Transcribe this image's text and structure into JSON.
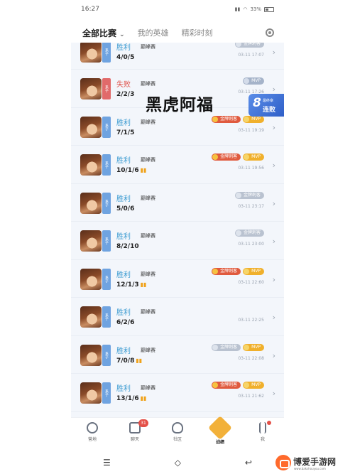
{
  "status_bar": {
    "time": "16:27",
    "battery": "33%"
  },
  "tabs": [
    {
      "label": "全部比赛",
      "active": true
    },
    {
      "label": "我的英雄",
      "active": false
    },
    {
      "label": "精彩时刻",
      "active": false
    }
  ],
  "overlay_text": "黑虎阿福",
  "streak": {
    "number": "8",
    "sub": "最终章",
    "label": "连败"
  },
  "matches": [
    {
      "result": "胜利",
      "mode": "巅峰赛",
      "kda": "4/0/5",
      "time": "03-11 17:07",
      "badges": [
        "silver"
      ],
      "tag": "系子",
      "fire": false
    },
    {
      "result": "失败",
      "mode": "巅峰赛",
      "kda": "2/2/3",
      "time": "03-11 17:26",
      "badges": [
        "mvps"
      ],
      "tag": "系子",
      "fire": false
    },
    {
      "result": "胜利",
      "mode": "巅峰赛",
      "kda": "7/1/5",
      "time": "03-11 19:19",
      "badges": [
        "gold",
        "mvp"
      ],
      "tag": "系子",
      "fire": false
    },
    {
      "result": "胜利",
      "mode": "巅峰赛",
      "kda": "10/1/6",
      "time": "03-11 19:56",
      "badges": [
        "gold",
        "mvp"
      ],
      "tag": "系子",
      "fire": true
    },
    {
      "result": "胜利",
      "mode": "巅峰赛",
      "kda": "5/0/6",
      "time": "03-11 23:17",
      "badges": [
        "silver"
      ],
      "tag": "系子",
      "fire": false
    },
    {
      "result": "胜利",
      "mode": "巅峰赛",
      "kda": "8/2/10",
      "time": "03-11 23:00",
      "badges": [
        "silver"
      ],
      "tag": "系子",
      "fire": false
    },
    {
      "result": "胜利",
      "mode": "巅峰赛",
      "kda": "12/1/3",
      "time": "03-11 22:60",
      "badges": [
        "gold",
        "mvp"
      ],
      "tag": "系子",
      "fire": true
    },
    {
      "result": "胜利",
      "mode": "巅峰赛",
      "kda": "6/2/6",
      "time": "03-11 22:25",
      "badges": [],
      "tag": "系子",
      "fire": false
    },
    {
      "result": "胜利",
      "mode": "巅峰赛",
      "kda": "7/0/8",
      "time": "03-11 22:08",
      "badges": [
        "silver",
        "mvp"
      ],
      "tag": "系子",
      "fire": true
    },
    {
      "result": "胜利",
      "mode": "巅峰赛",
      "kda": "13/1/6",
      "time": "03-11 21:62",
      "badges": [
        "gold",
        "mvp"
      ],
      "tag": "系子",
      "fire": true
    }
  ],
  "badge_labels": {
    "gold": "金牌刺客",
    "silver": "金牌刺客",
    "mvp": "MVP",
    "mvps": "MVP"
  },
  "bottom_nav": [
    {
      "label": "营地",
      "icon": "compass-icon",
      "count": ""
    },
    {
      "label": "聊天",
      "icon": "chat-icon",
      "count": "31"
    },
    {
      "label": "社区",
      "icon": "community-icon",
      "count": ""
    },
    {
      "label": "战绩",
      "icon": "record-icon",
      "count": "",
      "active": true
    },
    {
      "label": "我",
      "icon": "profile-icon",
      "count": "",
      "dot": true
    }
  ],
  "watermark": {
    "name": "博爱手游网",
    "url": "www.bakshouyou.com"
  },
  "colors": {
    "win": "#3b9bd1",
    "lose": "#e0524b",
    "accent": "#3b6fd8"
  }
}
